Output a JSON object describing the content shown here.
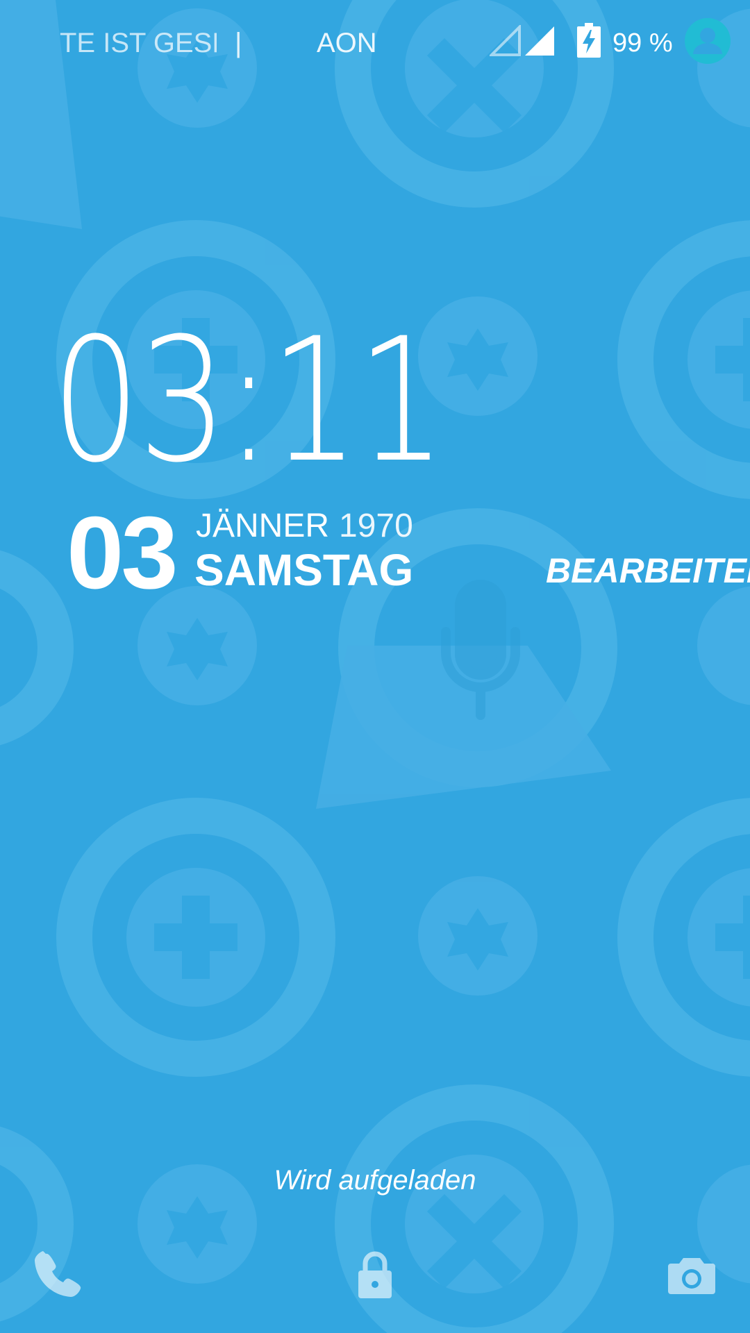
{
  "status_bar": {
    "carrier_ticker": "TE IST GESP",
    "separator": "|",
    "carrier": "AON",
    "signal_icons": [
      "signal-empty-icon",
      "signal-full-icon"
    ],
    "battery_icon": "battery-charging-icon",
    "battery_percent": "99 %",
    "avatar_icon": "user-avatar-icon"
  },
  "clock": {
    "hour": "03",
    "colon": ":",
    "minute": "11"
  },
  "date": {
    "day": "03",
    "month": "JÄNNER",
    "year": "1970",
    "weekday": "SAMSTAG"
  },
  "edit_label": "BEARBEITEN",
  "charging_status": "Wird aufgeladen",
  "bottom_bar": {
    "left_icon": "phone-icon",
    "center_icon": "lock-icon",
    "right_icon": "camera-icon"
  },
  "colors": {
    "background": "#32a6e0",
    "pattern": "#4fb5e6",
    "avatar": "#21bcd4",
    "text": "#ffffff"
  }
}
